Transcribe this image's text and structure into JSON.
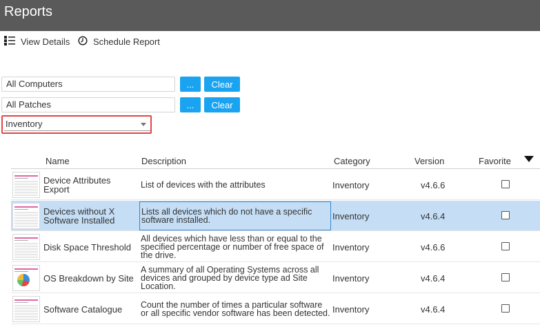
{
  "window": {
    "title": "Reports"
  },
  "toolbar": {
    "view_details_label": "View Details",
    "schedule_report_label": "Schedule Report"
  },
  "filters": {
    "computers": {
      "value": "All Computers",
      "browse_label": "...",
      "clear_label": "Clear"
    },
    "patches": {
      "value": "All Patches",
      "browse_label": "...",
      "clear_label": "Clear"
    },
    "category": {
      "selected": "Inventory"
    }
  },
  "table": {
    "columns": [
      "Name",
      "Description",
      "Category",
      "Version",
      "Favorite"
    ],
    "rows": [
      {
        "name": "Device Attributes Export",
        "description": "List of devices with the attributes",
        "category": "Inventory",
        "version": "v4.6.6",
        "favorite": false,
        "thumb": "table"
      },
      {
        "name": "Devices without X Software Installed",
        "description": "Lists all devices which do not have a specific software installed.",
        "category": "Inventory",
        "version": "v4.6.4",
        "favorite": false,
        "thumb": "table",
        "selected": true
      },
      {
        "name": "Disk Space Threshold",
        "description": "All devices which have less than or equal to the specified percentage or number of free space of the drive.",
        "category": "Inventory",
        "version": "v4.6.6",
        "favorite": false,
        "thumb": "table"
      },
      {
        "name": "OS Breakdown by Site",
        "description": "A summary of all Operating Systems across all devices and grouped by device type ad Site Location.",
        "category": "Inventory",
        "version": "v4.6.4",
        "favorite": false,
        "thumb": "pie"
      },
      {
        "name": "Software Catalogue",
        "description": "Count the number of times a particular software or all specific vendor software has been detected.",
        "category": "Inventory",
        "version": "v4.6.4",
        "favorite": false,
        "thumb": "table"
      }
    ]
  },
  "colors": {
    "titlebar": "#5a5a5a",
    "accent": "#1aa3f0",
    "selection": "#c5def5",
    "highlight": "#e04646"
  }
}
